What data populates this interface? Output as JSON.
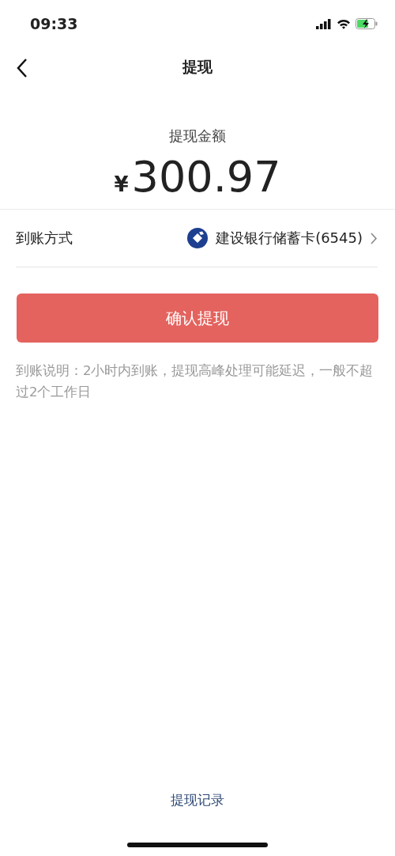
{
  "status_bar": {
    "time": "09:33"
  },
  "nav": {
    "title": "提现"
  },
  "amount": {
    "label": "提现金额",
    "currency": "¥",
    "value": "300.97"
  },
  "method": {
    "label": "到账方式",
    "bank": "建设银行储蓄卡(6545)"
  },
  "confirm_button": "确认提现",
  "note": "到账说明：2小时内到账，提现高峰处理可能延迟，一般不超过2个工作日",
  "records_link": "提现记录"
}
